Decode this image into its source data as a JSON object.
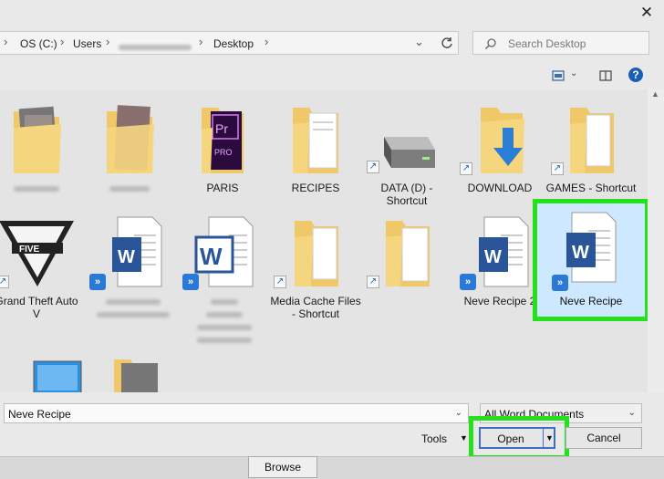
{
  "title_bar": {
    "close_glyph": "✕"
  },
  "address_bar": {
    "crumbs": [
      "OS (C:)",
      "Users",
      "Desktop"
    ],
    "separator": "›",
    "dropdown_glyph": "⌄"
  },
  "search": {
    "placeholder": "Search Desktop"
  },
  "help_glyph": "?",
  "items": [
    {
      "label": ""
    },
    {
      "label": ""
    },
    {
      "label": "PARIS"
    },
    {
      "label": "RECIPES"
    },
    {
      "label": "DATA (D) - Shortcut"
    },
    {
      "label": "DOWNLOAD"
    },
    {
      "label": "GAMES - Shortcut"
    },
    {
      "label": "Grand Theft Auto V"
    },
    {
      "label": ""
    },
    {
      "label": ""
    },
    {
      "label": "Media Cache Files - Shortcut"
    },
    {
      "label": ""
    },
    {
      "label": "Neve Recipe 2"
    },
    {
      "label": "Neve Recipe"
    }
  ],
  "filename": {
    "value": "Neve Recipe"
  },
  "filetype": {
    "value": "All Word Documents"
  },
  "buttons": {
    "tools": "Tools",
    "open": "Open",
    "cancel": "Cancel",
    "browse": "Browse"
  },
  "colors": {
    "highlight": "#25e01c",
    "selection": "#cde8ff",
    "folder": "#f0c868",
    "word_blue": "#2a5699"
  }
}
